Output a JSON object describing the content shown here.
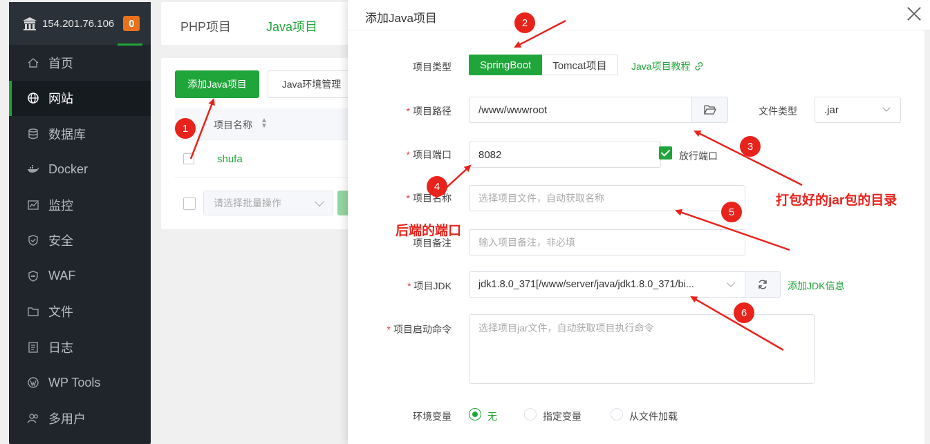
{
  "sidebar": {
    "ip": "154.201.76.106",
    "badge": "0",
    "items": [
      {
        "label": "首页",
        "icon": "home-icon"
      },
      {
        "label": "网站",
        "icon": "globe-icon",
        "active": true
      },
      {
        "label": "数据库",
        "icon": "database-icon"
      },
      {
        "label": "Docker",
        "icon": "docker-icon"
      },
      {
        "label": "监控",
        "icon": "monitor-icon"
      },
      {
        "label": "安全",
        "icon": "shield-icon"
      },
      {
        "label": "WAF",
        "icon": "waf-icon"
      },
      {
        "label": "文件",
        "icon": "folder-icon"
      },
      {
        "label": "日志",
        "icon": "log-icon"
      },
      {
        "label": "WP Tools",
        "icon": "wordpress-icon"
      },
      {
        "label": "多用户",
        "icon": "users-icon"
      }
    ]
  },
  "tabs": {
    "php": "PHP项目",
    "java": "Java项目"
  },
  "page": {
    "add_button": "添加Java项目",
    "env_button": "Java环境管理",
    "column_name": "项目名称",
    "row_name": "shufa",
    "batch_placeholder": "请选择批量操作"
  },
  "dialog": {
    "title": "添加Java项目",
    "type_label": "项目类型",
    "type_springboot": "SpringBoot",
    "type_tomcat": "Tomcat项目",
    "tutorial_link": "Java项目教程",
    "path_label": "项目路径",
    "path_value": "/www/wwwroot",
    "file_type_label": "文件类型",
    "file_type_value": ".jar",
    "port_label": "项目端口",
    "port_value": "8082",
    "open_port_label": "放行端口",
    "name_label": "项目名称",
    "name_placeholder": "选择项目文件，自动获取名称",
    "remark_label": "项目备注",
    "remark_placeholder": "输入项目备注，非必填",
    "jdk_label": "项目JDK",
    "jdk_value": "jdk1.8.0_371[/www/server/java/jdk1.8.0_371/bi...",
    "add_jdk_link": "添加JDK信息",
    "cmd_label": "项目启动命令",
    "cmd_placeholder": "选择项目jar文件，自动获取项目执行命令",
    "env_label": "环境变量",
    "env_options": [
      "无",
      "指定变量",
      "从文件加载"
    ]
  },
  "annotations": {
    "numbers": [
      "1",
      "2",
      "3",
      "4",
      "5",
      "6"
    ],
    "jar_dir_note": "打包好的jar包的目录",
    "port_note": "后端的端口"
  },
  "colors": {
    "accent": "#20a53a",
    "annotation": "#e8231c",
    "sidebar_bg": "#1f252b"
  }
}
